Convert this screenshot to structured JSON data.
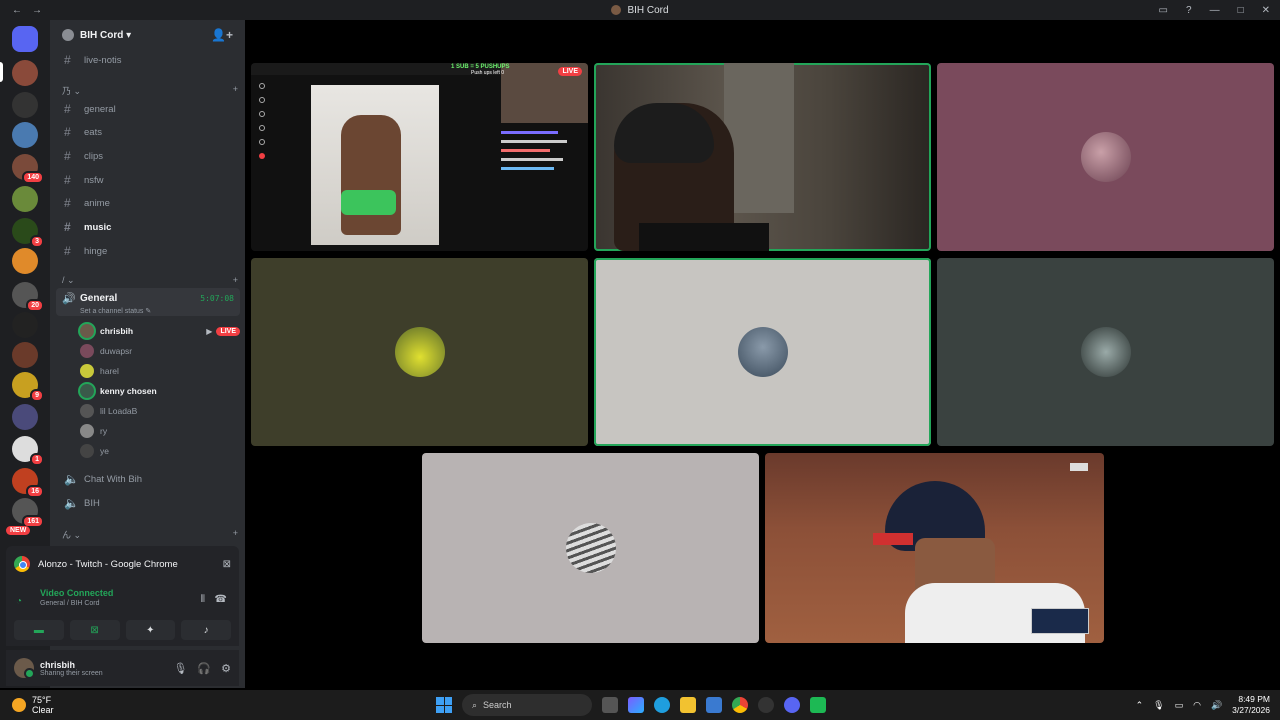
{
  "window": {
    "title": "BIH Cord",
    "back": "←",
    "forward": "→"
  },
  "server": {
    "name": "BIH Cord ▾",
    "invite_icon": "👤+"
  },
  "channels_top": [
    {
      "label": "live-notis"
    }
  ],
  "category_1": {
    "label": "乃 ⌄",
    "add": "+"
  },
  "channels": [
    {
      "label": "general"
    },
    {
      "label": "eats"
    },
    {
      "label": "clips"
    },
    {
      "label": "nsfw"
    },
    {
      "label": "anime"
    },
    {
      "label": "music"
    },
    {
      "label": "hinge"
    }
  ],
  "category_2": {
    "label": "/ ⌄",
    "add": "+"
  },
  "voice_channel": {
    "name": "General",
    "time": "5:07:08",
    "status": "Set a channel status ✎"
  },
  "members": [
    {
      "name": "chrisbih",
      "live": "LIVE",
      "color": "#6b5a4a"
    },
    {
      "name": "duwapsr",
      "color": "#7a4a5c"
    },
    {
      "name": "harel",
      "color": "#c9c93a"
    },
    {
      "name": "kenny chosen",
      "color": "#3a5a4a"
    },
    {
      "name": "lil LoadaB",
      "color": "#555"
    },
    {
      "name": "ry",
      "color": "#888"
    },
    {
      "name": "ye",
      "color": "#444"
    }
  ],
  "voice_channels_more": [
    {
      "label": "Chat With Bih"
    },
    {
      "label": "BIH"
    }
  ],
  "category_3": {
    "label": "ん ⌄",
    "add": "+"
  },
  "stream_card": {
    "label": "Alonzo - Twitch - Google Chrome"
  },
  "rtc": {
    "status": "Video Connected",
    "sub": "General / BIH Cord"
  },
  "user": {
    "name": "chrisbih",
    "status": "Sharing their screen"
  },
  "guild_badges": [
    "140",
    "3",
    "20",
    "9",
    "1",
    "16",
    "161",
    "NEW"
  ],
  "taskbar": {
    "temp": "75°F",
    "cond": "Clear",
    "search": "Search",
    "time": "8:49 PM",
    "date": "3/27/2026"
  },
  "stream_overlay": {
    "live": "LIVE",
    "pushups": "1 SUB = 5 PUSHUPS",
    "pushups2": "Push ups left 0"
  },
  "colors": {
    "accent": "#23a559",
    "danger": "#f23f43"
  }
}
